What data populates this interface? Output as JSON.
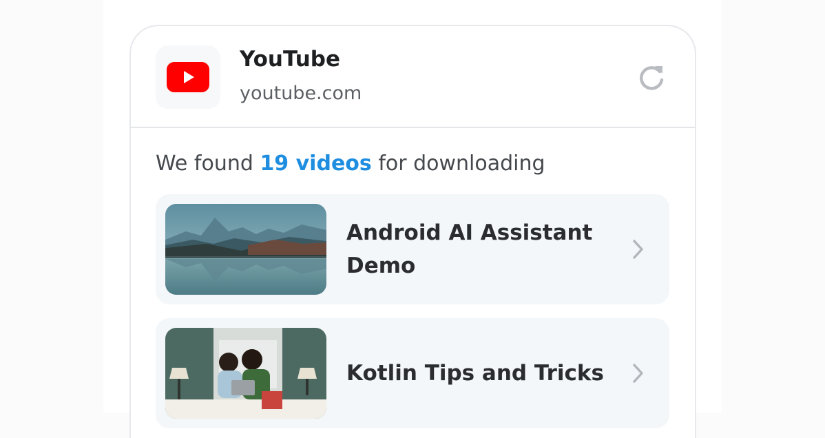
{
  "header": {
    "title": "YouTube",
    "url": "youtube.com",
    "icon": "youtube-logo-icon",
    "action_icon": "refresh-icon"
  },
  "summary": {
    "prefix": "We found",
    "count_text": "19 videos",
    "suffix": "for downloading"
  },
  "videos": [
    {
      "title": "Android AI Assistant Demo",
      "thumbnail": "mountain-lake-thumbnail"
    },
    {
      "title": "Kotlin Tips and Tricks",
      "thumbnail": "people-with-laptop-thumbnail"
    }
  ],
  "colors": {
    "accent": "#1f8ee0",
    "youtube_red": "#ff0000",
    "item_bg": "#f4f7f9"
  }
}
